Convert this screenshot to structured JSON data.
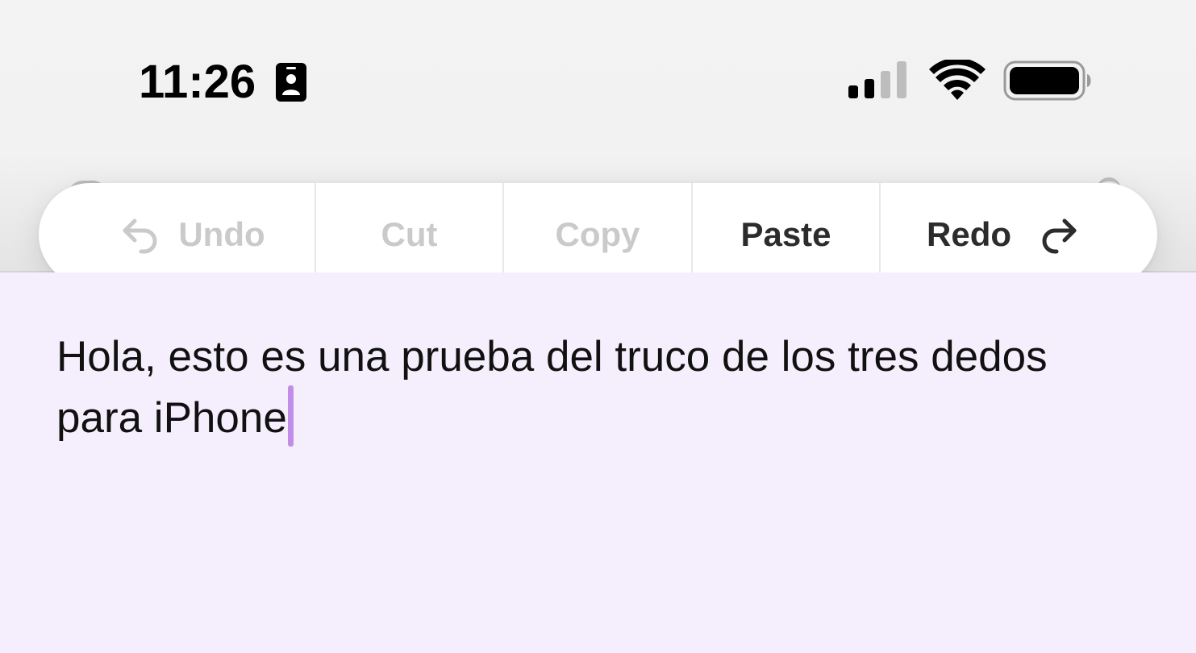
{
  "status_bar": {
    "time": "11:26",
    "focus_icon": "person-badge-icon",
    "signal_icon": "cellular-signal-icon",
    "signal_strength": "2 of 4 bars",
    "wifi_icon": "wifi-icon",
    "battery_icon": "battery-icon",
    "battery_level": 1.0
  },
  "edit_menu": {
    "items": [
      {
        "label": "Undo",
        "icon": "undo-arrow-icon",
        "enabled": false
      },
      {
        "label": "Cut",
        "enabled": false
      },
      {
        "label": "Copy",
        "enabled": false
      },
      {
        "label": "Paste",
        "enabled": true
      },
      {
        "label": "Redo",
        "icon": "redo-arrow-icon",
        "enabled": true
      }
    ]
  },
  "note": {
    "text": "Hola, esto es una prueba del truco de los tres dedos para iPhone"
  },
  "colors": {
    "note_background": "#f5effd",
    "caret": "#c08ee6",
    "disabled_text": "#cacaca",
    "enabled_text": "#2c2c2c"
  }
}
